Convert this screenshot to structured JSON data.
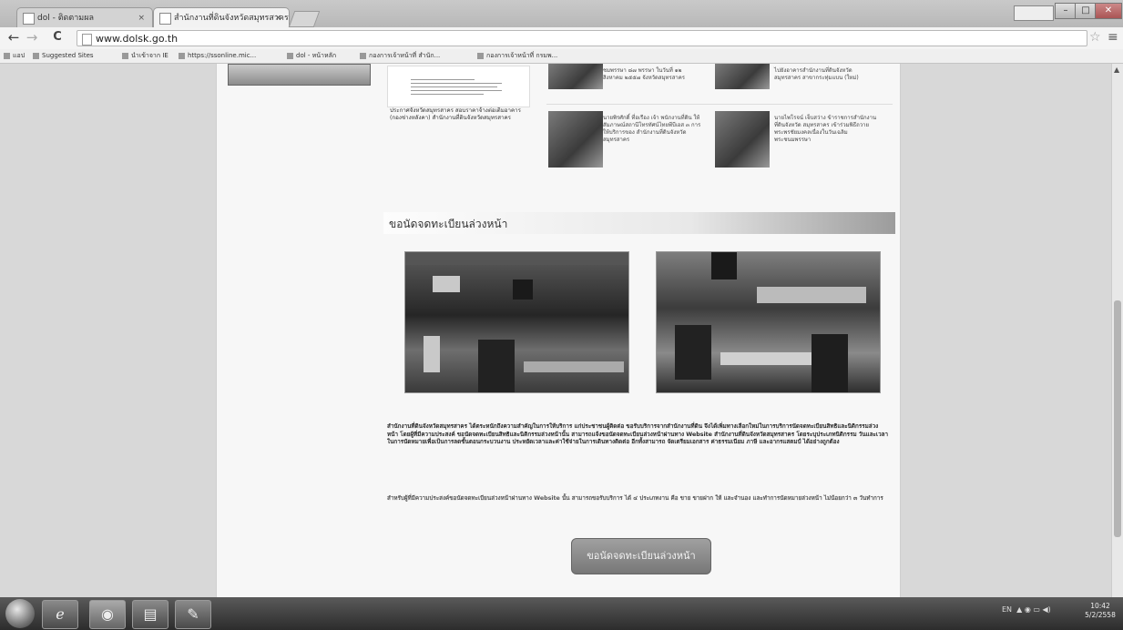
{
  "browser": {
    "tabs": [
      {
        "label": "dol - ติดตามผล"
      },
      {
        "label": "สำนักงานที่ดินจังหวัดสมุทรสาคร"
      }
    ],
    "close_glyph": "×",
    "user_badge": "",
    "window_buttons": {
      "minimize": "–",
      "maximize": "□",
      "close": "✕"
    },
    "nav": {
      "back": "←",
      "forward": "→",
      "reload": "C"
    },
    "url": "www.dolsk.go.th",
    "star_icon": "☆",
    "menu_icon": "≡"
  },
  "bookmarks": [
    {
      "label": "แอป"
    },
    {
      "label": "Suggested Sites"
    },
    {
      "label": "นำเข้าจาก IE"
    },
    {
      "label": "https://ssonline.mic..."
    },
    {
      "label": "dol - หน้าหลัก"
    },
    {
      "label": "กองการเจ้าหน้าที่ สำนัก..."
    },
    {
      "label": "กองการเจ้าหน้าที่ กรมพ..."
    }
  ],
  "page": {
    "left_caption": "ประกาศจังหวัดสมุทรสาคร สอบราคาจ้างต่อเติมอาคาร (กองช่างหลังคา) สำนักงานที่ดินจังหวัดสมุทรสาคร",
    "news": [
      {
        "caption": "ชมพรรษา ๘๗ พรรษา ในวันที่ ๑๒ สิงหาคม ๒๕๕๗ จังหวัดสมุทรสาคร"
      },
      {
        "caption": "ไปยังอาคารสำนักงานที่ดินจังหวัดสมุทรสาคร สาขากระทุ่มแบน (ใหม่)"
      },
      {
        "caption": "นายพิรศักดิ์ ที่อเรือง เจ้า พนักงานที่ดิน ให้สัมภาษณ์สถานีโทรทัศน์ไทยพีบีเอส ๓ การให้บริการของ สำนักงานที่ดินจังหวัดสมุทรสาคร"
      },
      {
        "caption": "นายไพโรจน์ เจ็บสว่าง ข้าราชการสำนักงานที่ดินจังหวัด สมุทรสาคร เข้าร่วมพิธีถวายพระพรชัยมงคลเนื่องในวันเฉลิมพระชนมพรรษา"
      }
    ],
    "section_title": "ขอนัดจดทะเบียนล่วงหน้า",
    "paragraph_1": "สำนักงานที่ดินจังหวัดสมุทรสาคร ได้ตระหนักถึงความสำคัญในการให้บริการ แก่ประชาชนผู้ติดต่อ ขอรับบริการจากสำนักงานที่ดิน จึงได้เพิ่มทางเลือกใหม่ในการบริการนัดจดทะเบียนสิทธิและนิติกรรมล่วงหน้า โดยผู้ที่มีความประสงค์ ขอนัดจดทะเบียนสิทธิและนิติกรรมล่วงหน้านั้น สามารถแจ้งขอนัดจดทะเบียนล่วงหน้าผ่านทาง Website สำนักงานที่ดินจังหวัดสมุทรสาคร โดยระบุประเภทนิติกรรม วันและเวลาในการนัดหมายเพื่อเป็นการลดขั้นตอนกระบวนงาน ประหยัดเวลาและค่าใช้จ่ายในการเดินทางติดต่อ อีกทั้งสามารถ จัดเตรียมเอกสาร ค่าธรรมเนียม ภาษี และอากรแสตมป์ ได้อย่างถูกต้อง",
    "paragraph_2": "สำหรับผู้ที่มีความประสงค์ขอนัดจดทะเบียนล่วงหน้าผ่านทาง Website นั้น สามารถขอรับบริการ ได้ ๔ ประเภทงาน คือ ขาย ขายฝาก ให้ และจำนอง และทำการนัดหมายล่วงหน้า ไม่น้อยกว่า ๓ วันทำการ",
    "cta_label": "ขอนัดจดทะเบียนล่วงหน้า"
  },
  "taskbar": {
    "apps": [
      {
        "icon": "internet-explorer-icon",
        "glyph": "e"
      },
      {
        "icon": "chrome-icon",
        "glyph": "◉"
      },
      {
        "icon": "file-explorer-icon",
        "glyph": "▤"
      },
      {
        "icon": "paint-icon",
        "glyph": "✎"
      }
    ],
    "tray_lang": "EN",
    "time": "10:42",
    "date": "5/2/2558"
  }
}
